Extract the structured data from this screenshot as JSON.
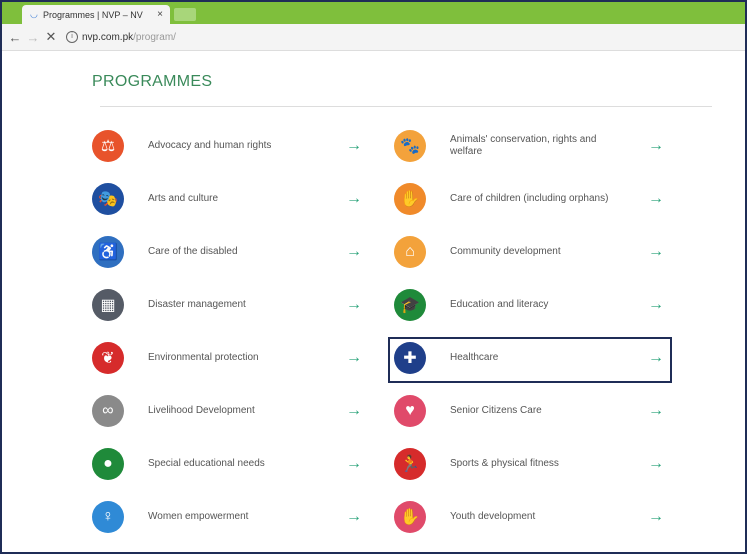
{
  "browser": {
    "tab_title": "Programmes | NVP – NV",
    "tab_close": "×",
    "back": "←",
    "forward": "→",
    "reload": "✕",
    "address_host": "nvp.com.pk",
    "address_path": "/program/"
  },
  "page": {
    "heading": "PROGRAMMES",
    "arrow": "→",
    "items": [
      {
        "label": "Advocacy and human rights",
        "icon": "scales-icon",
        "glyph": "⚖",
        "color": "#e8532b"
      },
      {
        "label": "Animals' conservation, rights and welfare",
        "icon": "paw-icon",
        "glyph": "🐾",
        "color": "#f3a23b"
      },
      {
        "label": "Arts and culture",
        "icon": "theatre-masks-icon",
        "glyph": "🎭",
        "color": "#1f4fa0"
      },
      {
        "label": "Care of children (including orphans)",
        "icon": "children-icon",
        "glyph": "✋",
        "color": "#f08a2a"
      },
      {
        "label": "Care of the disabled",
        "icon": "wheelchair-icon",
        "glyph": "♿",
        "color": "#2f6fc0"
      },
      {
        "label": "Community development",
        "icon": "community-icon",
        "glyph": "⌂",
        "color": "#f3a23b"
      },
      {
        "label": "Disaster management",
        "icon": "building-icon",
        "glyph": "▦",
        "color": "#555b66"
      },
      {
        "label": "Education and literacy",
        "icon": "graduation-cap-icon",
        "glyph": "🎓",
        "color": "#1f8a3a"
      },
      {
        "label": "Environmental protection",
        "icon": "leaf-icon",
        "glyph": "❦",
        "color": "#d62b2b"
      },
      {
        "label": "Healthcare",
        "icon": "medical-kit-icon",
        "glyph": "✚",
        "color": "#1f3f8a"
      },
      {
        "label": "Livelihood Development",
        "icon": "link-icon",
        "glyph": "∞",
        "color": "#8a8a8a"
      },
      {
        "label": "Senior Citizens Care",
        "icon": "heart-stethoscope-icon",
        "glyph": "♥",
        "color": "#e04a6a"
      },
      {
        "label": "Special educational needs",
        "icon": "person-icon",
        "glyph": "●",
        "color": "#1f8a3a"
      },
      {
        "label": "Sports & physical fitness",
        "icon": "runner-icon",
        "glyph": "🏃",
        "color": "#d62b2b"
      },
      {
        "label": "Women empowerment",
        "icon": "woman-icon",
        "glyph": "♀",
        "color": "#2f8ad6"
      },
      {
        "label": "Youth development",
        "icon": "raised-hand-icon",
        "glyph": "✋",
        "color": "#e04a6a"
      }
    ]
  }
}
